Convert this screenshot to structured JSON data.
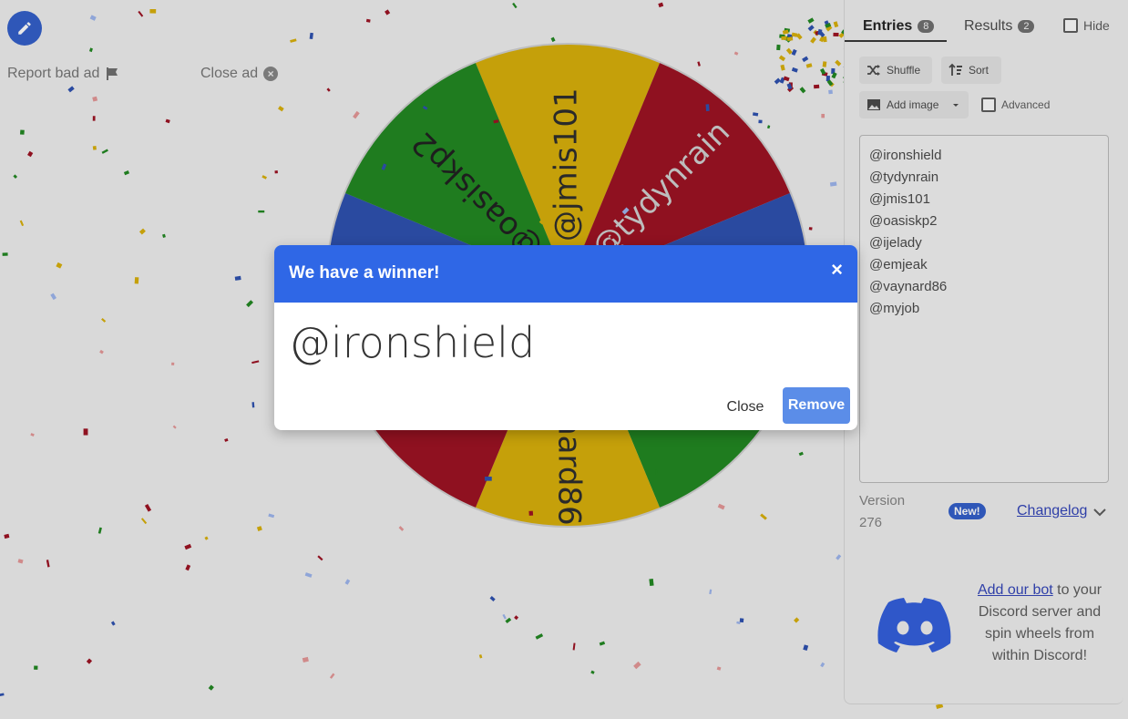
{
  "ads": {
    "report_label": "Report bad ad",
    "close_label": "Close ad"
  },
  "wheel": {
    "slice_colors": [
      "#c5a00a",
      "#8f1120",
      "#2a4aa0",
      "#1f7c1f",
      "#c5a00a",
      "#8f1120",
      "#2a4aa0",
      "#1f7c1f"
    ],
    "visible_labels": [
      "@jmis101",
      "@tydynrain",
      "@oasiskp2",
      "@vaynard86"
    ]
  },
  "tabs": {
    "entries_label": "Entries",
    "entries_count": "8",
    "results_label": "Results",
    "results_count": "2",
    "hide_label": "Hide"
  },
  "toolbar": {
    "shuffle_label": "Shuffle",
    "sort_label": "Sort",
    "add_image_label": "Add image",
    "advanced_label": "Advanced"
  },
  "entries": [
    "@ironshield",
    "@tydynrain",
    "@jmis101",
    "@oasiskp2",
    "@ijelady",
    "@emjeak",
    "@vaynard86",
    "@myjob"
  ],
  "version": {
    "label": "Version",
    "number": "276",
    "new_badge": "New!",
    "changelog_label": "Changelog"
  },
  "discord": {
    "link_label": "Add our bot",
    "text_1": " to your Discord server and spin wheels from within Discord!"
  },
  "modal": {
    "title": "We have a winner!",
    "close_icon": "×",
    "winner": "@ironshield",
    "close_label": "Close",
    "remove_label": "Remove"
  },
  "colors": {
    "modal_header": "#2f67e6",
    "remove_button": "#5b8de8",
    "edit_button": "#2f57b8"
  }
}
